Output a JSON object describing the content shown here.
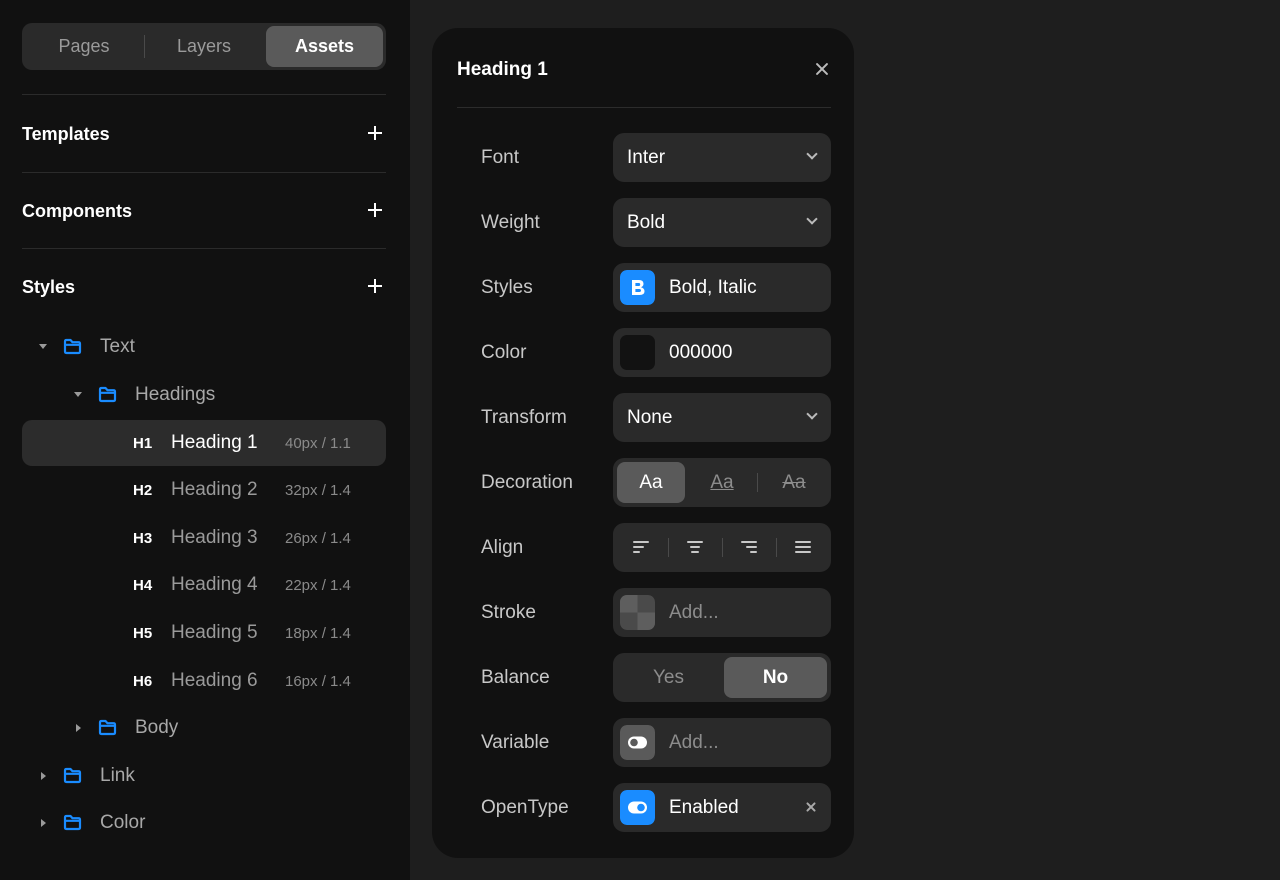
{
  "sidebar": {
    "tabs": [
      {
        "label": "Pages"
      },
      {
        "label": "Layers"
      },
      {
        "label": "Assets",
        "active": true
      }
    ],
    "sections": [
      {
        "title": "Templates"
      },
      {
        "title": "Components"
      },
      {
        "title": "Styles"
      }
    ],
    "tree": {
      "text": {
        "label": "Text"
      },
      "headings": {
        "label": "Headings"
      },
      "items": [
        {
          "tag": "H1",
          "name": "Heading 1",
          "meta": "40px / 1.1"
        },
        {
          "tag": "H2",
          "name": "Heading 2",
          "meta": "32px / 1.4"
        },
        {
          "tag": "H3",
          "name": "Heading 3",
          "meta": "26px / 1.4"
        },
        {
          "tag": "H4",
          "name": "Heading 4",
          "meta": "22px / 1.4"
        },
        {
          "tag": "H5",
          "name": "Heading 5",
          "meta": "18px / 1.4"
        },
        {
          "tag": "H6",
          "name": "Heading 6",
          "meta": "16px / 1.4"
        }
      ],
      "body": {
        "label": "Body"
      },
      "link": {
        "label": "Link"
      },
      "color": {
        "label": "Color"
      }
    }
  },
  "panel": {
    "title": "Heading 1",
    "rows": {
      "font": {
        "label": "Font",
        "value": "Inter"
      },
      "weight": {
        "label": "Weight",
        "value": "Bold"
      },
      "styles": {
        "label": "Styles",
        "value": "Bold, Italic"
      },
      "color": {
        "label": "Color",
        "value": "000000"
      },
      "transform": {
        "label": "Transform",
        "value": "None"
      },
      "decoration": {
        "label": "Decoration",
        "options": [
          "Aa",
          "Aa",
          "Aa"
        ]
      },
      "align": {
        "label": "Align"
      },
      "stroke": {
        "label": "Stroke",
        "placeholder": "Add..."
      },
      "balance": {
        "label": "Balance",
        "options": [
          "Yes",
          "No"
        ],
        "selected": "No"
      },
      "variable": {
        "label": "Variable",
        "placeholder": "Add..."
      },
      "opentype": {
        "label": "OpenType",
        "value": "Enabled"
      }
    }
  },
  "colors": {
    "accent": "#1a8cff",
    "panel_bg": "#111111",
    "canvas_bg": "#1e1e1e",
    "field_bg": "#2a2a2a",
    "swatch_color": "#000000"
  },
  "icons": [
    "plus-icon",
    "folder-icon",
    "caret-icon",
    "close-icon",
    "chevron-down-icon",
    "bold-icon",
    "toggle-icon",
    "align-left-icon",
    "align-center-icon",
    "align-right-icon",
    "align-justify-icon",
    "checker-icon"
  ]
}
